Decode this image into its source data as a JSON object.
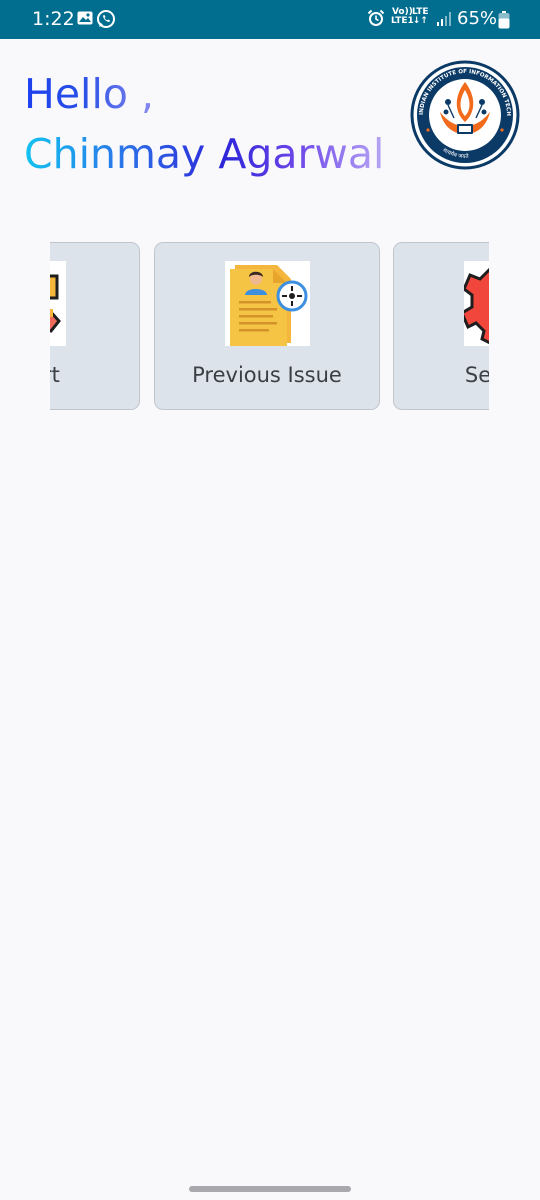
{
  "status_bar": {
    "time": "1:22",
    "volte_line1": "Vo))",
    "volte_line2": "LTE1",
    "lte_line1": "LTE",
    "lte_line2": "↓↑",
    "battery": "65%",
    "icons": [
      "gallery-icon",
      "whatsapp-icon",
      "alarm-icon",
      "signal-icon",
      "battery-icon"
    ],
    "background_color": "#016e8f"
  },
  "greeting": {
    "hello": "Hello ,",
    "name": "Chinmay Agarwal"
  },
  "logo": {
    "ring_text_top": "INDIAN INSTITUTE OF INFORMATION TECHNOLOGY KOTA",
    "ring_text_bottom": "सत्यमेव जयते",
    "ring_color": "#0b3a66",
    "flame_color": "#f26a1b"
  },
  "cards": [
    {
      "label": "Report",
      "visible_label": "rt",
      "icon": "report-icon"
    },
    {
      "label": "Previous Issue",
      "visible_label": "Previous Issue",
      "icon": "resume-document-icon"
    },
    {
      "label": "Settings",
      "visible_label": "Set",
      "icon": "settings-gear-icon"
    }
  ]
}
